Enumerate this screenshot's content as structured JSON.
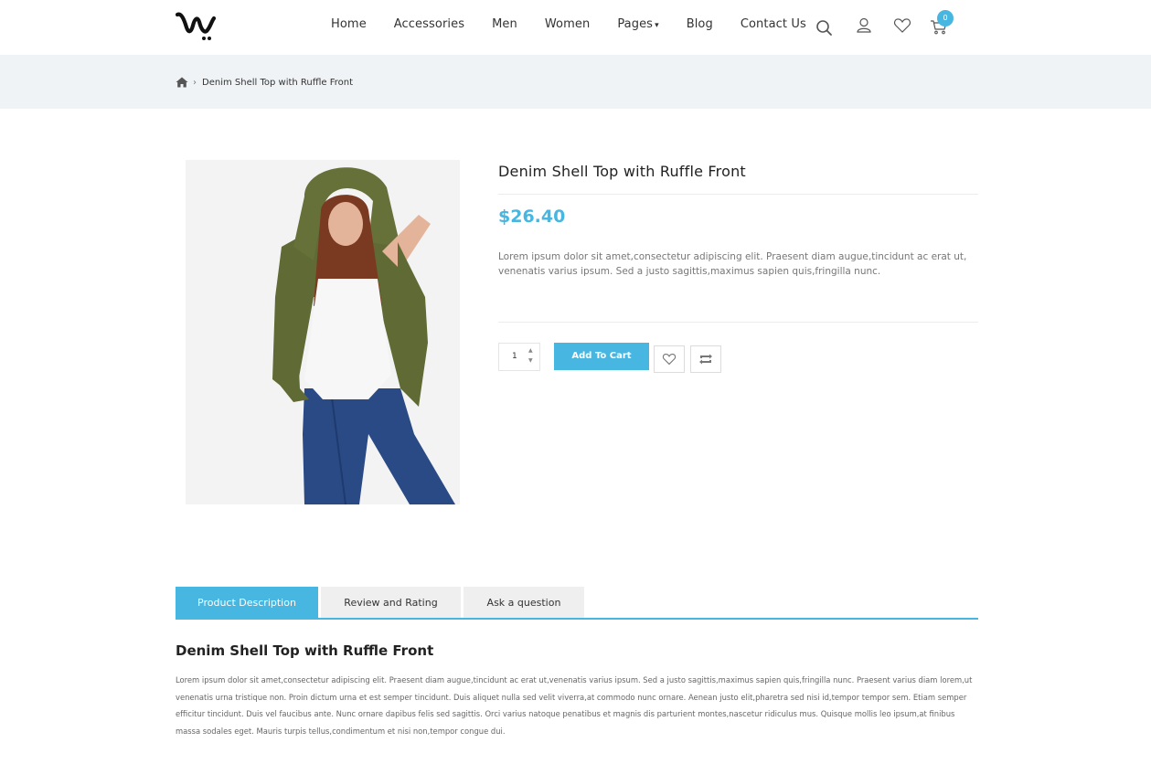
{
  "header": {
    "nav": [
      "Home",
      "Accessories",
      "Men",
      "Women",
      "Pages",
      "Blog",
      "Contact Us"
    ],
    "cart_count": "0"
  },
  "breadcrumb": {
    "current": "Denim Shell Top with Ruffle Front"
  },
  "product": {
    "title": "Denim Shell Top with Ruffle Front",
    "price": "$26.40",
    "short_description": "Lorem ipsum dolor sit amet,consectetur adipiscing elit. Praesent diam augue,tincidunt ac erat ut, venenatis varius ipsum. Sed a justo sagittis,maximus sapien quis,fringilla nunc.",
    "quantity": "1",
    "add_to_cart_label": "Add To Cart"
  },
  "tabs": [
    "Product Description",
    "Review and Rating",
    "Ask a question"
  ],
  "description": {
    "title": "Denim Shell Top with Ruffle Front",
    "body": "Lorem ipsum dolor sit amet,consectetur adipiscing elit. Praesent diam augue,tincidunt ac erat ut,venenatis varius ipsum. Sed a justo sagittis,maximus sapien quis,fringilla nunc. Praesent varius diam lorem,ut venenatis urna tristique non. Proin dictum urna et est semper tincidunt. Duis aliquet nulla sed velit viverra,at commodo nunc ornare. Aenean justo elit,pharetra sed nisi id,tempor tempor sem. Etiam semper efficitur tincidunt. Duis vel faucibus ante. Nunc ornare dapibus felis sed sagittis. Orci varius natoque penatibus et magnis dis parturient montes,nascetur ridiculus mus. Quisque mollis leo ipsum,at finibus massa sodales eget. Mauris turpis tellus,condimentum et nisi non,tempor congue dui."
  },
  "colors": {
    "accent": "#47b6e0",
    "breadcrumb_bg": "#f0f3f6",
    "tab_inactive_bg": "#efefef"
  },
  "icons": [
    "logo-w",
    "search-icon",
    "user-icon",
    "heart-icon",
    "cart-icon",
    "home-icon",
    "chevron-right-icon",
    "heart-outline-icon",
    "compare-icon"
  ]
}
